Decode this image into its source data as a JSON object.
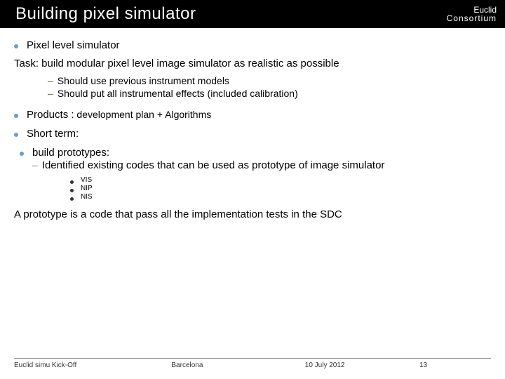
{
  "header": {
    "title": "Building pixel simulator",
    "org_line1": "Euclid",
    "org_line2": "Consortium"
  },
  "bullets": {
    "b1": "Pixel level simulator",
    "task_label": "Task:",
    "task_text": " build modular pixel level image simulator as realistic as possible",
    "sub1": "Should use previous instrument models",
    "sub2": "Should put all instrumental effects (included calibration)",
    "products_label": "Products :",
    "products_text": " development plan + Algorithms",
    "short_term": "Short term:",
    "build_proto": "build prototypes:",
    "proto_item": "Identified existing codes that can be used as prototype of image simulator",
    "tiny1": "VIS",
    "tiny2": "NIP",
    "tiny3": "NIS",
    "closing": "A prototype is a code that  pass all the implementation tests in the SDC"
  },
  "footer": {
    "left": "Euclid simu Kick-Off",
    "center": "Barcelona",
    "date": "10 July 2012",
    "page": "13"
  }
}
